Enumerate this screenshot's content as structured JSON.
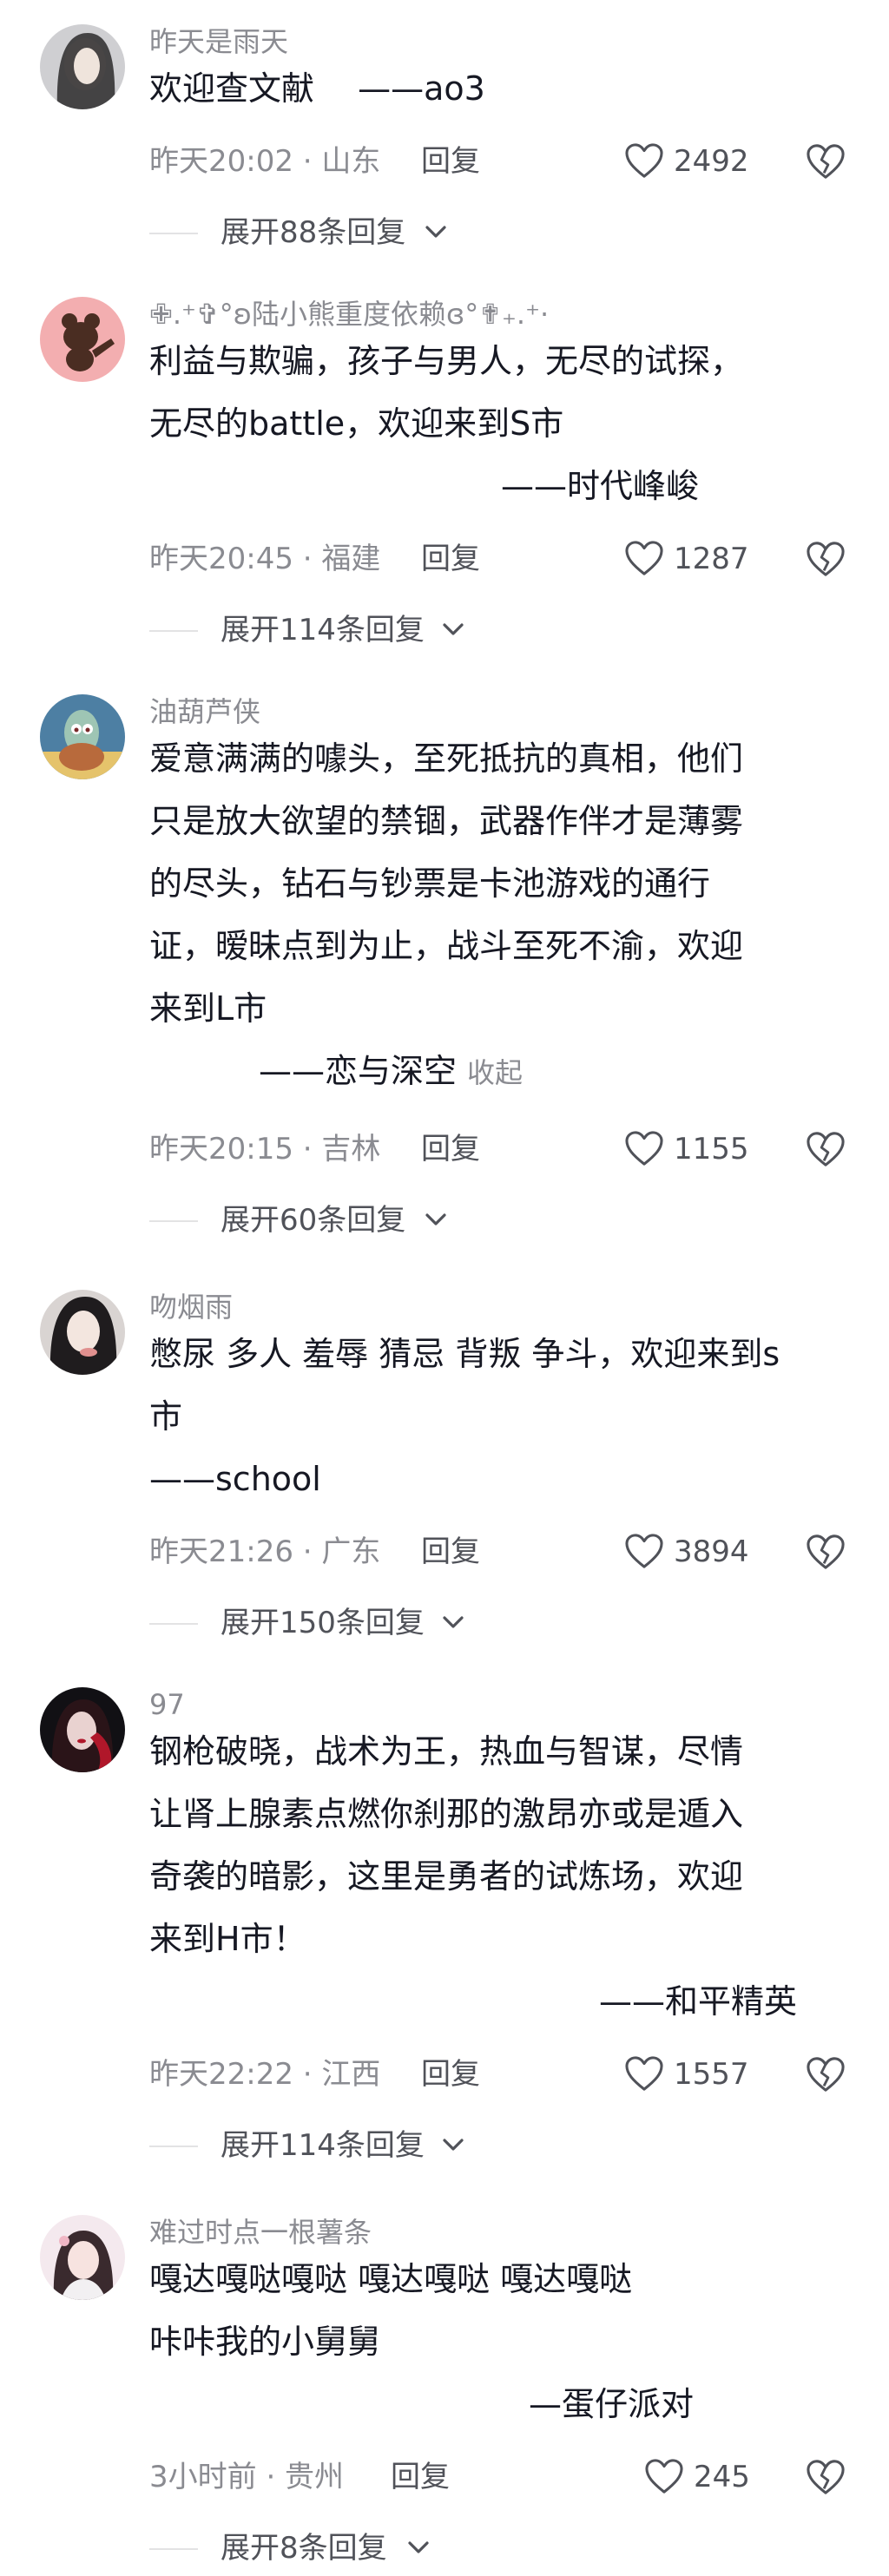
{
  "comments": [
    {
      "username": "昨天是雨天",
      "lines": [
        "欢迎查文献　 ——ao3"
      ],
      "time": "昨天20:02 · 山东",
      "reply": "回复",
      "likes": "2492",
      "expand": "展开88条回复"
    },
    {
      "username": "✙.⁺✞°ʚ陆小熊重度依赖ɞ°✟₊.⁺·",
      "lines": [
        "利益与欺骗，孩子与男人，无尽的试探，",
        "无尽的battle，欢迎来到S市",
        "——时代峰峻"
      ],
      "time": "昨天20:45 · 福建",
      "reply": "回复",
      "likes": "1287",
      "expand": "展开114条回复"
    },
    {
      "username": "油葫芦侠",
      "lines": [
        "爱意满满的噱头，至死抵抗的真相，他们",
        "只是放大欲望的禁锢，武器作伴才是薄雾",
        "的尽头，钻石与钞票是卡池游戏的通行",
        "证，暧昧点到为止，战斗至死不渝，欢迎",
        "来到L市",
        "——恋与深空"
      ],
      "collapse": "收起",
      "time": "昨天20:15 · 吉林",
      "reply": "回复",
      "likes": "1155",
      "expand": "展开60条回复"
    },
    {
      "username": "吻烟雨",
      "lines": [
        "憋尿 多人 羞辱 猜忌 背叛 争斗，欢迎来到s",
        "市",
        "——school"
      ],
      "time": "昨天21:26 · 广东",
      "reply": "回复",
      "likes": "3894",
      "expand": "展开150条回复"
    },
    {
      "username": "97",
      "lines": [
        "钢枪破晓，战术为王，热血与智谋，尽情",
        "让肾上腺素点燃你刹那的激昂亦或是遁入",
        "奇袭的暗影，这里是勇者的试炼场，欢迎",
        "来到H市！",
        "——和平精英"
      ],
      "time": "昨天22:22 · 江西",
      "reply": "回复",
      "likes": "1557",
      "expand": "展开114条回复"
    },
    {
      "username": "难过时点一根薯条",
      "lines": [
        "嘎达嘎哒嘎哒 嘎达嘎哒 嘎达嘎哒",
        "咔咔我的小舅舅",
        "—蛋仔派对"
      ],
      "time": "3小时前 · 贵州",
      "reply": "回复",
      "likes": "245",
      "expand": "展开8条回复"
    }
  ],
  "icons": {
    "like": "heart-outline-icon",
    "dislike": "broken-heart-outline-icon",
    "expand": "chevron-down-icon"
  },
  "colors": {
    "primary_text": "#161823",
    "secondary_text": "#8a8b91",
    "action_text": "#505259"
  }
}
